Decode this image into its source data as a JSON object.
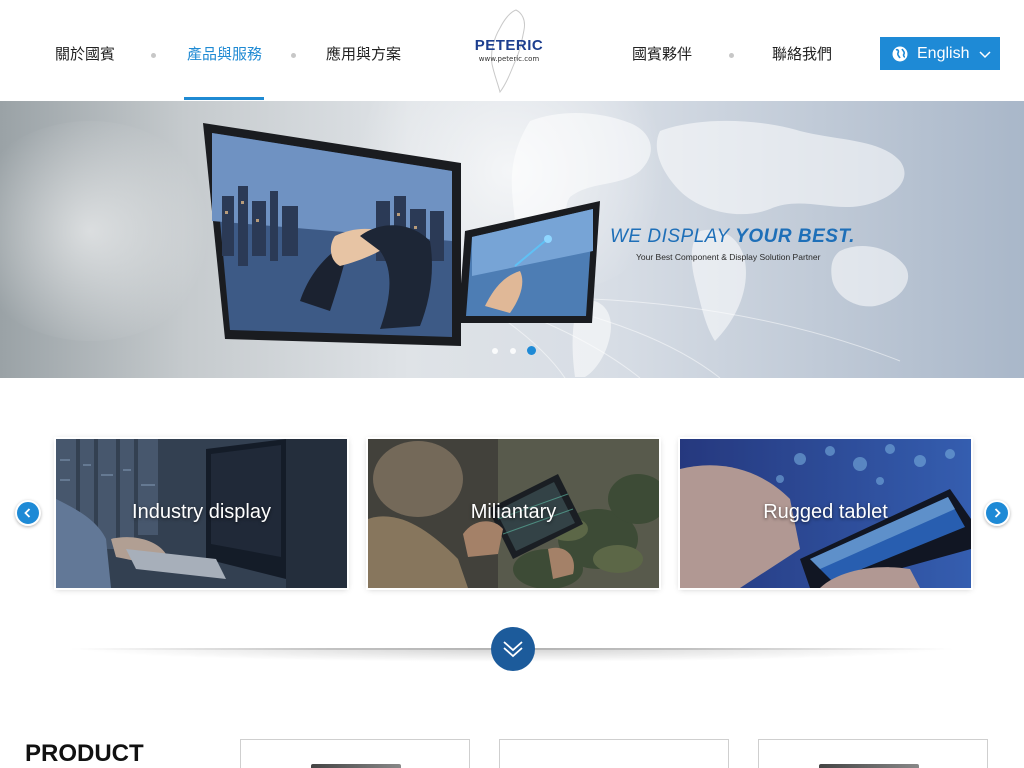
{
  "nav": {
    "items": [
      {
        "label": "關於國賓"
      },
      {
        "label": "產品與服務"
      },
      {
        "label": "應用與方案"
      },
      {
        "label": "國賓夥伴"
      },
      {
        "label": "聯絡我們"
      }
    ],
    "active_index": 1
  },
  "logo": {
    "name": "PETERIC",
    "url": "www.peteric.com"
  },
  "language": {
    "label": "English",
    "icon": "globe-icon"
  },
  "hero": {
    "title_light": "WE DISPLAY ",
    "title_bold": "YOUR BEST.",
    "subtitle": "Your Best Component & Display Solution Partner",
    "slide_count": 3,
    "active_slide": 3
  },
  "categories": [
    {
      "label": "Industry display"
    },
    {
      "label": "Miliantary"
    },
    {
      "label": "Rugged tablet"
    }
  ],
  "product": {
    "title": "PRODUCT"
  },
  "colors": {
    "accent": "#1e8ad6",
    "logo": "#1d3f8f",
    "scroll_button": "#1c5b9b"
  }
}
